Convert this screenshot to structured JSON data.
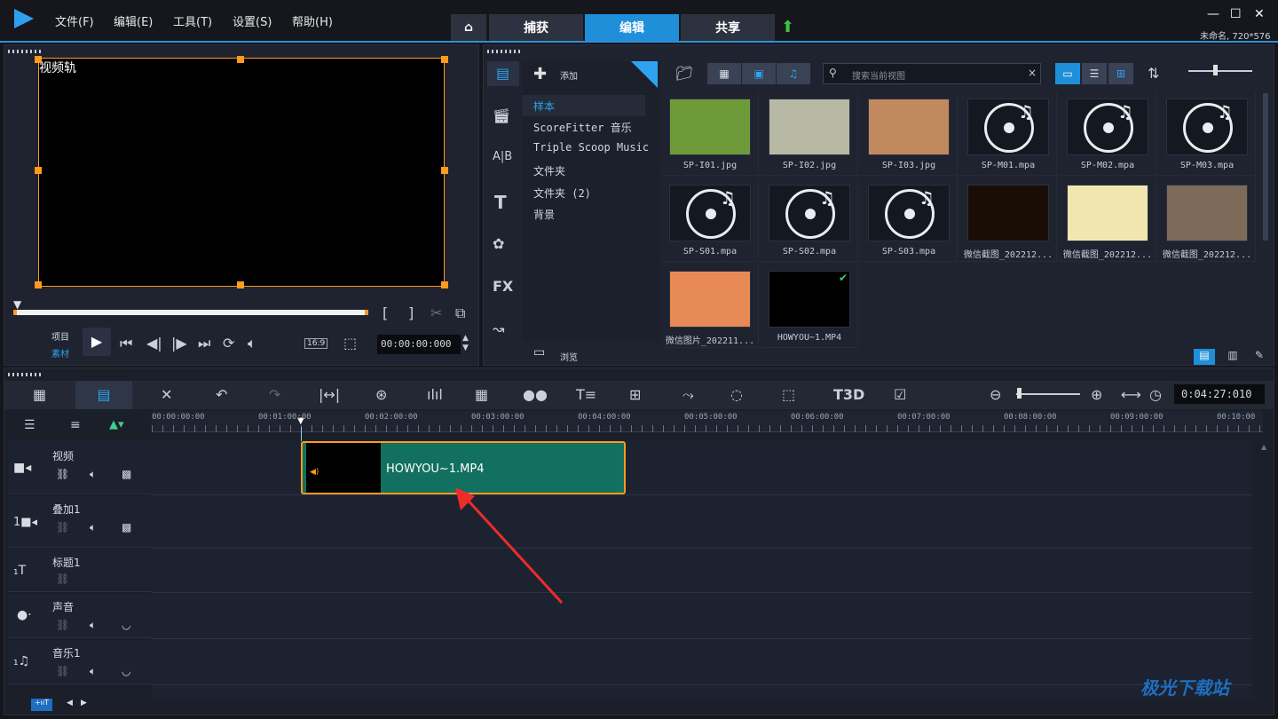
{
  "menu": [
    "文件(F)",
    "编辑(E)",
    "工具(T)",
    "设置(S)",
    "帮助(H)"
  ],
  "tabs": {
    "capture": "捕获",
    "edit": "编辑",
    "share": "共享"
  },
  "project_info": "未命名, 720*576",
  "preview": {
    "track_label": "视频轨",
    "mode_project": "项目",
    "mode_clip": "素材",
    "aspect": "16:9",
    "timecode": "00:00:00:000"
  },
  "library": {
    "add_label": "添加",
    "browse_label": "浏览",
    "search_placeholder": "搜索当前视图",
    "folders": [
      "样本",
      "ScoreFitter 音乐",
      "Triple Scoop Music",
      "文件夹",
      "文件夹 (2)",
      "背景"
    ],
    "items": [
      {
        "name": "SP-I01.jpg",
        "kind": "image",
        "color": "#6f9a3a"
      },
      {
        "name": "SP-I02.jpg",
        "kind": "image",
        "color": "#b7b9a4"
      },
      {
        "name": "SP-I03.jpg",
        "kind": "image",
        "color": "#c08a5e"
      },
      {
        "name": "SP-M01.mpa",
        "kind": "audio"
      },
      {
        "name": "SP-M02.mpa",
        "kind": "audio"
      },
      {
        "name": "SP-M03.mpa",
        "kind": "audio"
      },
      {
        "name": "SP-S01.mpa",
        "kind": "audio"
      },
      {
        "name": "SP-S02.mpa",
        "kind": "audio"
      },
      {
        "name": "SP-S03.mpa",
        "kind": "audio"
      },
      {
        "name": "微信截图_202212...",
        "kind": "image",
        "color": "#1a0d05"
      },
      {
        "name": "微信截图_202212...",
        "kind": "image",
        "color": "#f2e6b0"
      },
      {
        "name": "微信截图_202212...",
        "kind": "image",
        "color": "#7d6a58"
      },
      {
        "name": "微信图片_202211...",
        "kind": "image",
        "color": "#e78a55"
      },
      {
        "name": "HOWYOU~1.MP4",
        "kind": "video",
        "color": "#000000"
      }
    ]
  },
  "timeline": {
    "duration": "0:04:27:010",
    "ruler": [
      "00:00:00:00",
      "00:01:00:00",
      "00:02:00:00",
      "00:03:00:00",
      "00:04:00:00",
      "00:05:00:00",
      "00:06:00:00",
      "00:07:00:00",
      "00:08:00:00",
      "00:09:00:00",
      "00:10:00"
    ],
    "tracks": [
      {
        "name": "视频"
      },
      {
        "name": "叠加1"
      },
      {
        "name": "标题1"
      },
      {
        "name": "声音"
      },
      {
        "name": "音乐1"
      }
    ],
    "clip": {
      "label": "HOWYOU~1.MP4"
    }
  },
  "watermark": "极光下载站"
}
